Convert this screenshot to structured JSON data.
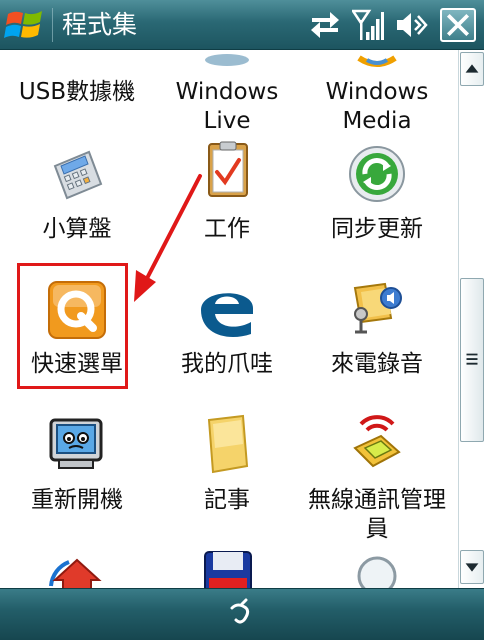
{
  "titlebar": {
    "title": "程式集",
    "start_icon": "windows-flag-icon",
    "status_icons": [
      "connectivity-arrows-icon",
      "signal-strength-icon",
      "volume-icon"
    ],
    "close_label": "✕"
  },
  "programs": [
    {
      "label": "USB數據機",
      "icon": "usb-modem-icon"
    },
    {
      "label": "Windows Live",
      "icon": "windows-live-icon"
    },
    {
      "label": "Windows Media",
      "icon": "windows-media-icon"
    },
    {
      "label": "小算盤",
      "icon": "calculator-icon"
    },
    {
      "label": "工作",
      "icon": "tasks-icon"
    },
    {
      "label": "同步更新",
      "icon": "sync-icon"
    },
    {
      "label": "快速選單",
      "icon": "quick-menu-icon"
    },
    {
      "label": "我的爪哇",
      "icon": "java-icon"
    },
    {
      "label": "來電錄音",
      "icon": "call-recorder-icon"
    },
    {
      "label": "重新開機",
      "icon": "reset-computer-icon"
    },
    {
      "label": "記事",
      "icon": "notes-icon"
    },
    {
      "label": "無線通訊管理員",
      "icon": "wireless-manager-icon"
    }
  ],
  "annotation": {
    "highlighted": "快速選單",
    "color": "#e01818"
  },
  "colors": {
    "titlebar": "#2a6874",
    "bottombar": "#235e69",
    "highlight": "#e01818"
  }
}
